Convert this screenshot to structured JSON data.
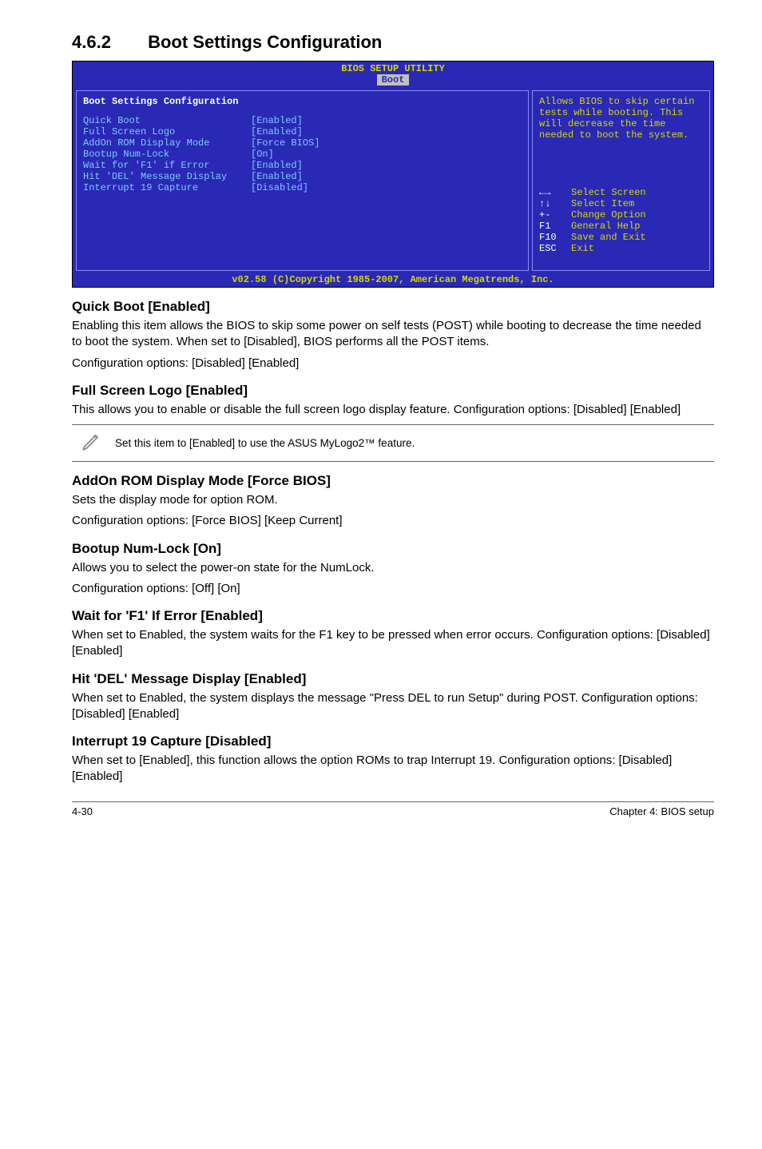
{
  "section": {
    "number": "4.6.2",
    "title": "Boot Settings Configuration"
  },
  "bios": {
    "header": "BIOS SETUP UTILITY",
    "tab": "Boot",
    "panel_title": "Boot Settings Configuration",
    "rows": [
      {
        "label": "Quick Boot",
        "value": "[Enabled]"
      },
      {
        "label": "Full Screen Logo",
        "value": "[Enabled]"
      },
      {
        "label": "AddOn ROM Display Mode",
        "value": "[Force BIOS]"
      },
      {
        "label": "Bootup Num-Lock",
        "value": "[On]"
      },
      {
        "label": "Wait for 'F1' if Error",
        "value": "[Enabled]"
      },
      {
        "label": "Hit 'DEL' Message Display",
        "value": "[Enabled]"
      },
      {
        "label": "Interrupt 19 Capture",
        "value": "[Disabled]"
      }
    ],
    "help": "Allows BIOS to skip certain tests while booting. This will decrease the time needed to boot the system.",
    "nav": {
      "select_screen": "Select Screen",
      "select_item": "Select Item",
      "change_option_key": "+-",
      "change_option": "Change Option",
      "general_help_key": "F1",
      "general_help": "General Help",
      "save_exit_key": "F10",
      "save_exit": "Save and Exit",
      "exit_key": "ESC",
      "exit": "Exit"
    },
    "footer": "v02.58 (C)Copyright 1985-2007, American Megatrends, Inc."
  },
  "items": {
    "quick_boot": {
      "heading": "Quick Boot [Enabled]",
      "p1": "Enabling this item allows the BIOS to skip some power on self tests (POST) while booting to decrease the time needed to boot the system. When set to [Disabled], BIOS performs all the POST items.",
      "p2": "Configuration options: [Disabled] [Enabled]"
    },
    "full_screen_logo": {
      "heading": "Full Screen Logo [Enabled]",
      "p1": "This allows you to enable or disable the full screen logo display feature. Configuration options: [Disabled] [Enabled]"
    },
    "note": "Set this item to [Enabled] to use the ASUS MyLogo2™ feature.",
    "addon_rom": {
      "heading": "AddOn ROM Display Mode [Force BIOS]",
      "p1": "Sets the display mode for option ROM.",
      "p2": "Configuration options: [Force BIOS] [Keep Current]"
    },
    "bootup_numlock": {
      "heading": "Bootup Num-Lock [On]",
      "p1": "Allows you to select the power-on state for the NumLock.",
      "p2": "Configuration options: [Off] [On]"
    },
    "wait_f1": {
      "heading": "Wait for 'F1' If Error [Enabled]",
      "p1": "When set to Enabled, the system waits for the F1 key to be pressed when error occurs. Configuration options: [Disabled] [Enabled]"
    },
    "hit_del": {
      "heading": "Hit 'DEL' Message Display [Enabled]",
      "p1": "When set to Enabled, the system displays the message \"Press DEL to run Setup\" during POST. Configuration options: [Disabled] [Enabled]"
    },
    "interrupt19": {
      "heading": "Interrupt 19 Capture [Disabled]",
      "p1": "When set to [Enabled], this function allows the option ROMs to trap Interrupt 19. Configuration options: [Disabled] [Enabled]"
    }
  },
  "footer": {
    "left": "4-30",
    "right": "Chapter 4: BIOS setup"
  }
}
